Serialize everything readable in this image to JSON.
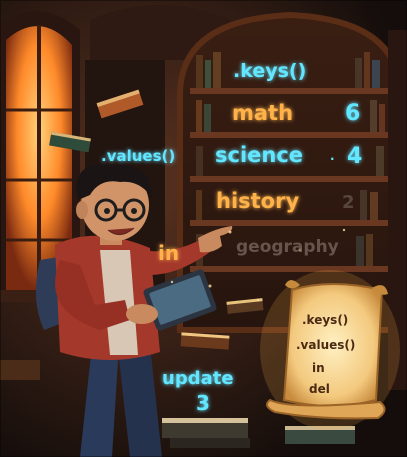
{
  "colors": {
    "cyan_text": "#63e6ff",
    "orange_text": "#ffb24a",
    "scroll_ink": "#4a2a12",
    "window_glow": "#ff8a2a",
    "hoodie": "#a4382b",
    "shelf_wood": "#5a2d17"
  },
  "labels": {
    "keys_title": ".keys()",
    "values_call": ".values()",
    "key_math": "math",
    "key_science": "science",
    "key_history": "history",
    "key_geography": "geography",
    "value_math": "6",
    "value_science": "4",
    "value_history": "2",
    "in_keyword": "in",
    "update_label": "update",
    "update_value": "3"
  },
  "scroll": {
    "lines": [
      ".keys()",
      ".values()",
      "in",
      "del"
    ]
  },
  "icons": {
    "window": "gothic-window",
    "tablet": "tablet-device",
    "books": "floating-books",
    "scroll": "parchment-scroll"
  }
}
